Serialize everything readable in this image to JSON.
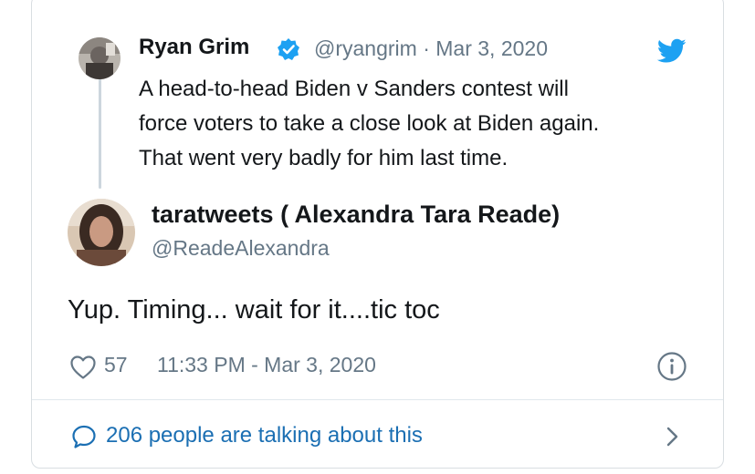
{
  "quoted": {
    "name": "Ryan Grim",
    "handle_date": "@ryangrim · Mar 3, 2020",
    "text_lines": [
      "A head-to-head Biden v Sanders contest will",
      "force voters to take a close look at Biden again.",
      "That went very badly for him last time."
    ],
    "verified_icon": "verified-badge-icon",
    "brand_icon": "twitter-bird-icon"
  },
  "tweet": {
    "name": "taratweets ( Alexandra Tara Reade)",
    "handle": "@ReadeAlexandra",
    "text": "Yup. Timing... wait for it....tic toc",
    "likes": "57",
    "timestamp": "11:33 PM - Mar 3, 2020",
    "like_icon": "heart-icon",
    "info_icon": "info-icon"
  },
  "footer": {
    "talking": "206 people are talking about this",
    "bubble_icon": "comment-bubble-icon",
    "chevron_icon": "chevron-right-icon"
  },
  "colors": {
    "twitter_blue": "#1da1f2",
    "link_blue": "#1b6fb3",
    "muted": "#657786",
    "text": "#14171a"
  }
}
